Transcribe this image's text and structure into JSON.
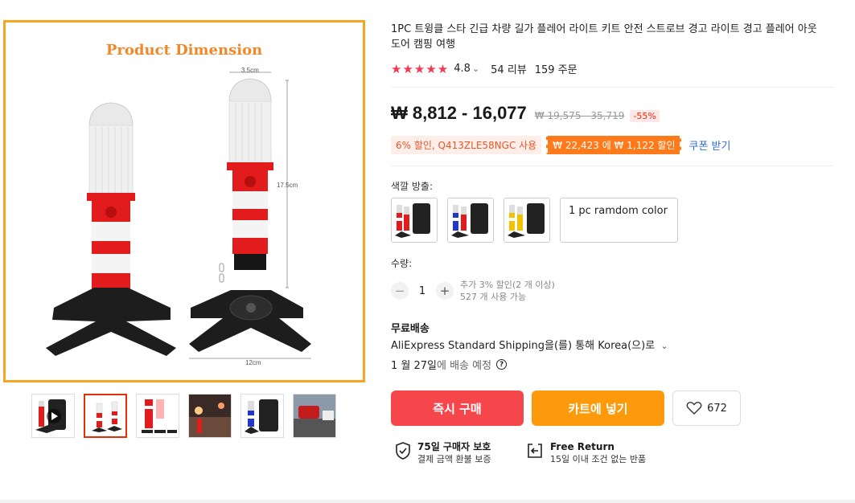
{
  "product": {
    "title": "1PC 트윙클 스타 긴급 차량 길가 플레어 라이트 키트 안전 스트로브 경고 라이트 경고 플레어 아웃 도어 캠핑 여행",
    "image_caption": "Product Dimension",
    "dimensions": {
      "width_top": "3.5cm",
      "height": "17.5cm",
      "base": "12cm"
    }
  },
  "rating": {
    "stars": "★★★★★",
    "score": "4.8",
    "chevron": "⌄",
    "reviews": "54 리뷰",
    "orders": "159 주문"
  },
  "price": {
    "current": "₩ 8,812 - 16,077",
    "original": "₩ 19,575 - 35,719",
    "discount": "-55%"
  },
  "coupons": {
    "code_text": "6% 할인, Q413ZLE58NGC 사용",
    "deal_text": "₩ 22,423 에 ₩ 1,122 할인",
    "link": "쿠폰 받기"
  },
  "color": {
    "label": "색깔 방출:",
    "text_option": "1 pc ramdom color"
  },
  "quantity": {
    "label": "수량:",
    "minus": "−",
    "value": "1",
    "plus": "+",
    "note1": "추가 3% 할인(2 개 이상)",
    "note2": "527 개 사용 가능"
  },
  "shipping": {
    "title": "무료배송",
    "method": "AliExpress Standard Shipping을(를) 통해 Korea(으)로",
    "chevron": "⌄",
    "date_bold": "1 월 27일",
    "date_rest": "에 배송 예정",
    "help": "?"
  },
  "buttons": {
    "buy": "즉시 구매",
    "cart": "카트에 넣기",
    "wish_count": "672"
  },
  "guarantees": {
    "protect_title": "75일 구매자 보호",
    "protect_sub": "결제 금액 환불 보증",
    "return_title": "Free Return",
    "return_sub": "15일 이내 조건 없는 반품"
  },
  "colors": {
    "accent": "#f5464c",
    "cart": "#fd9a0c",
    "border_active": "#e62e04",
    "star": "#f5374f"
  }
}
